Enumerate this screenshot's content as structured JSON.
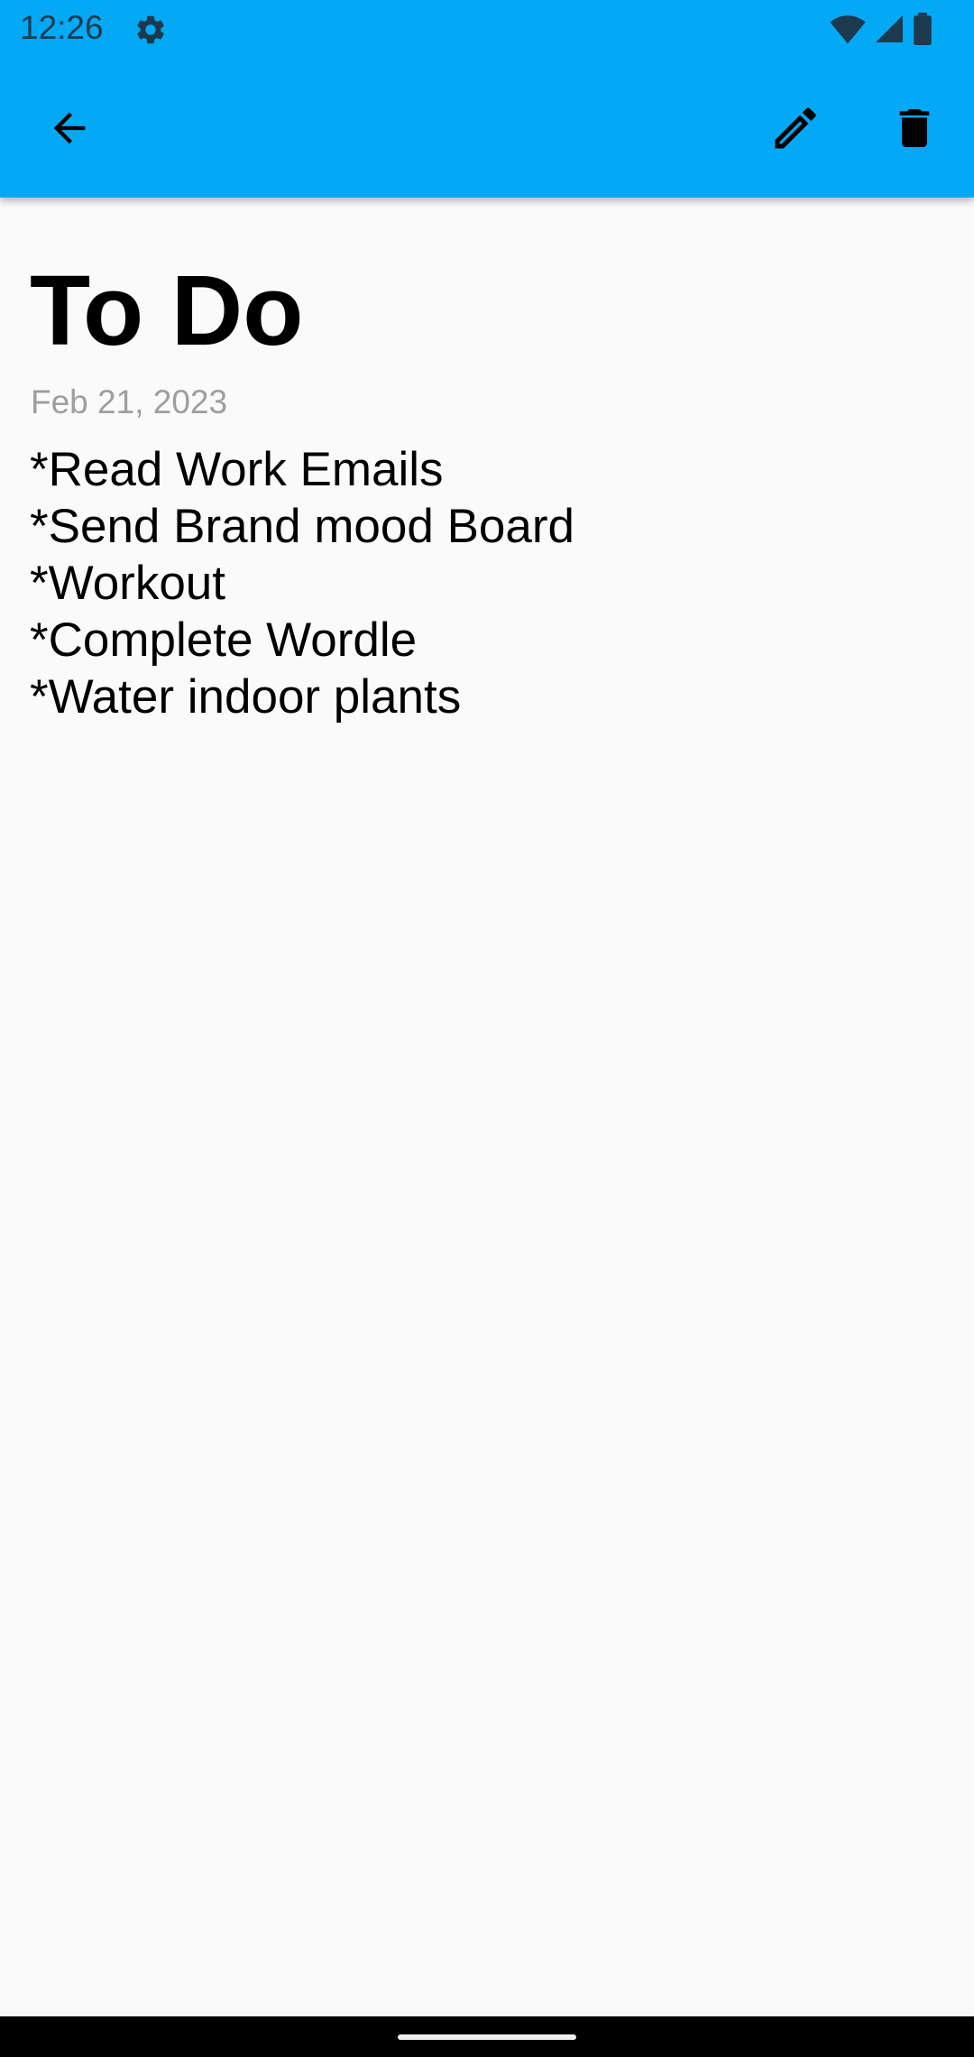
{
  "status_bar": {
    "time": "12:26",
    "icons": [
      "gear-icon",
      "wifi-icon",
      "signal-icon",
      "battery-icon"
    ]
  },
  "toolbar": {
    "back_icon": "arrow-back-icon",
    "edit_icon": "pencil-icon",
    "delete_icon": "trash-icon",
    "background_color": "#03a9f4"
  },
  "note": {
    "title": "To Do",
    "date": "Feb 21, 2023",
    "lines": [
      "*Read Work Emails",
      "*Send Brand mood Board",
      "*Workout",
      "*Complete Wordle",
      "*Water indoor plants"
    ]
  }
}
